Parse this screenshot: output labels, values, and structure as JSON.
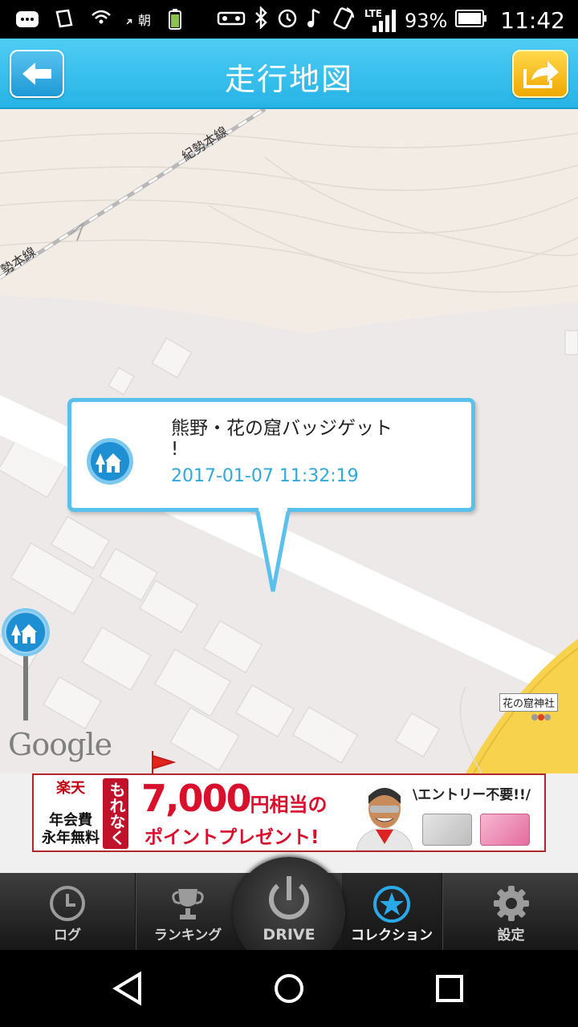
{
  "status_bar": {
    "battery_percent": "93%",
    "network": "LTE",
    "time": "11:42",
    "notification_text": "朝"
  },
  "header": {
    "title": "走行地図",
    "back_icon": "back-arrow-icon",
    "share_icon": "share-icon"
  },
  "map": {
    "rail_label_1": "紀勢本線",
    "rail_label_2": "勢本線",
    "poi_label": "花の窟神社",
    "attribution": "Google"
  },
  "balloon": {
    "title": "熊野・花の窟バッジゲット！",
    "title_line1": "熊野・花の窟バッジゲット",
    "title_line2": "!",
    "timestamp": "2017-01-07 11:32:19"
  },
  "ad": {
    "brand_line1": "楽天",
    "brand_line2": "年会費",
    "brand_line3": "永年無料",
    "vertical_text": "もれなく",
    "headline_number": "7,000",
    "headline_suffix": "円相当の",
    "subline": "ポイントプレゼント!",
    "entry_text": "\\エントリー不要!!/"
  },
  "tabs": [
    {
      "label": "ログ",
      "icon": "clock-icon",
      "active": false
    },
    {
      "label": "ランキング",
      "icon": "trophy-icon",
      "active": false
    },
    {
      "label": "DRIVE",
      "icon": "power-icon",
      "active": false
    },
    {
      "label": "コレクション",
      "icon": "star-icon",
      "active": true
    },
    {
      "label": "設定",
      "icon": "gear-icon",
      "active": false
    }
  ],
  "colors": {
    "header": "#2bb7e8",
    "accent_text": "#2fa9dd",
    "balloon_border": "#5bc1ec",
    "share_button": "#f5b400",
    "ad_red": "#d8102c"
  }
}
